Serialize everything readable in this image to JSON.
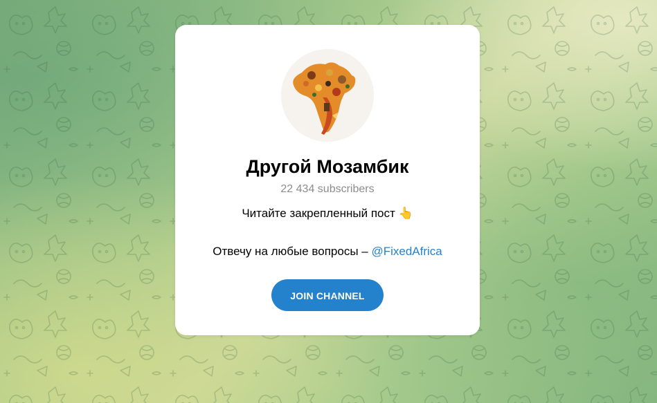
{
  "channel": {
    "title": "Другой Мозамбик",
    "subscribers": "22 434 subscribers",
    "description_line1": "Читайте закрепленный пост 👆",
    "description_line2_prefix": "Отвечу на любые вопросы – ",
    "description_line2_link": "@FixedAfrica",
    "avatar_icon": "africa-map-collage-icon"
  },
  "actions": {
    "join_label": "JOIN CHANNEL"
  },
  "colors": {
    "accent": "#2481cc",
    "subtitle": "#8c8c8c",
    "card": "#ffffff"
  }
}
